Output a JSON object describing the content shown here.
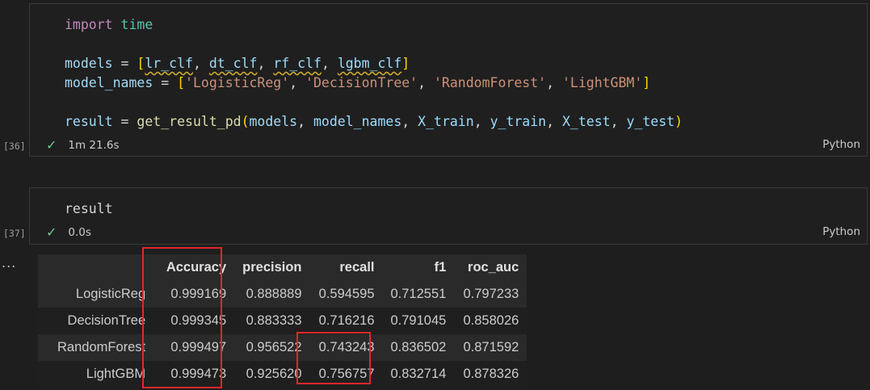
{
  "cell1": {
    "execution_count": "[36]",
    "lines": {
      "l1_import": "import",
      "l1_module": "time",
      "l3_var": "models",
      "l3_items": [
        "lr_clf",
        "dt_clf",
        "rf_clf",
        "lgbm_clf"
      ],
      "l4_var": "model_names",
      "l4_items": [
        "'LogisticReg'",
        "'DecisionTree'",
        "'RandomForest'",
        "'LightGBM'"
      ],
      "l6_var": "result",
      "l6_func": "get_result_pd",
      "l6_args": [
        "models",
        "model_names",
        "X_train",
        "y_train",
        "X_test",
        "y_test"
      ]
    },
    "status_time": "1m 21.6s",
    "language": "Python"
  },
  "cell2": {
    "execution_count": "[37]",
    "code": "result",
    "status_time": "0.0s",
    "language": "Python"
  },
  "output": {
    "ellipsis": "...",
    "columns": [
      "",
      "Accuracy",
      "precision",
      "recall",
      "f1",
      "roc_auc"
    ],
    "rows": [
      [
        "LogisticReg",
        "0.999169",
        "0.888889",
        "0.594595",
        "0.712551",
        "0.797233"
      ],
      [
        "DecisionTree",
        "0.999345",
        "0.883333",
        "0.716216",
        "0.791045",
        "0.858026"
      ],
      [
        "RandomForest",
        "0.999497",
        "0.956522",
        "0.743243",
        "0.836502",
        "0.871592"
      ],
      [
        "LightGBM",
        "0.999473",
        "0.925620",
        "0.756757",
        "0.832714",
        "0.878326"
      ]
    ],
    "highlight_color": "#e0282b"
  }
}
